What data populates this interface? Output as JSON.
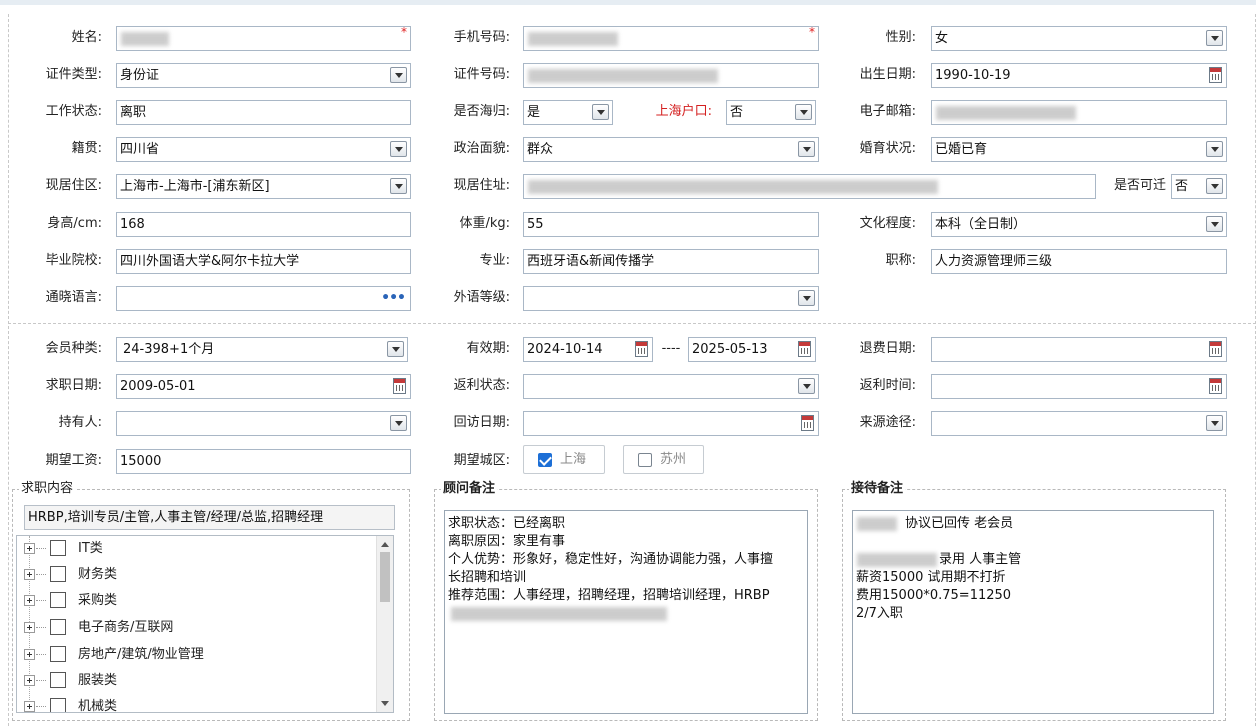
{
  "required_mark": "*",
  "basic": {
    "name": {
      "label": "姓名:",
      "value": ""
    },
    "phone": {
      "label": "手机号码:",
      "value": ""
    },
    "gender": {
      "label": "性别:",
      "value": "女"
    },
    "id_type": {
      "label": "证件类型:",
      "value": "身份证"
    },
    "id_no": {
      "label": "证件号码:",
      "value": ""
    },
    "birth": {
      "label": "出生日期:",
      "value": "1990-10-19"
    },
    "work_status": {
      "label": "工作状态:",
      "value": "离职"
    },
    "returnee": {
      "label": "是否海归:",
      "value": "是"
    },
    "shanghai_hukou": {
      "label": "上海户口:",
      "value": "否"
    },
    "email": {
      "label": "电子邮箱:",
      "value": ""
    },
    "native": {
      "label": "籍贯:",
      "value": "四川省"
    },
    "politics": {
      "label": "政治面貌:",
      "value": "群众"
    },
    "marriage": {
      "label": "婚育状况:",
      "value": "已婚已育"
    },
    "residence_area": {
      "label": "现居住区:",
      "value": "上海市-上海市-[浦东新区]"
    },
    "address": {
      "label": "现居住址:",
      "value": ""
    },
    "relocate": {
      "label": "是否可迁",
      "value": "否"
    },
    "height": {
      "label": "身高/cm:",
      "value": "168"
    },
    "weight": {
      "label": "体重/kg:",
      "value": "55"
    },
    "education": {
      "label": "文化程度:",
      "value": "本科（全日制）"
    },
    "school": {
      "label": "毕业院校:",
      "value": "四川外国语大学&阿尔卡拉大学"
    },
    "major": {
      "label": "专业:",
      "value": "西班牙语&新闻传播学"
    },
    "title": {
      "label": "职称:",
      "value": "人力资源管理师三级"
    },
    "language": {
      "label": "通晓语言:",
      "value": "",
      "more": "•••"
    },
    "fl_level": {
      "label": "外语等级:",
      "value": ""
    }
  },
  "member": {
    "type": {
      "label": "会员种类:",
      "value": "24-398+1个月"
    },
    "validity": {
      "label": "有效期:",
      "from": "2024-10-14",
      "sep": "----",
      "to": "2025-05-13"
    },
    "refund_date": {
      "label": "退费日期:",
      "value": ""
    },
    "job_date": {
      "label": "求职日期:",
      "value": "2009-05-01"
    },
    "rebate_status": {
      "label": "返利状态:",
      "value": ""
    },
    "rebate_time": {
      "label": "返利时间:",
      "value": ""
    },
    "holder": {
      "label": "持有人:",
      "value": ""
    },
    "visit_date": {
      "label": "回访日期:",
      "value": ""
    },
    "source": {
      "label": "来源途径:",
      "value": ""
    },
    "salary": {
      "label": "期望工资:",
      "value": "15000"
    },
    "city": {
      "label": "期望城区:",
      "options": [
        {
          "label": "上海",
          "checked": true
        },
        {
          "label": "苏州",
          "checked": false
        }
      ]
    }
  },
  "job_content": {
    "legend": "求职内容",
    "selected": "HRBP,培训专员/主管,人事主管/经理/总监,招聘经理",
    "tree": [
      "IT类",
      "财务类",
      "采购类",
      "电子商务/互联网",
      "房地产/建筑/物业管理",
      "服装类",
      "机械类"
    ]
  },
  "advisor_notes": {
    "legend": "顾问备注",
    "lines": [
      "求职状态：已经离职",
      "离职原因：家里有事",
      "个人优势：形象好，稳定性好，沟通协调能力强，人事擅",
      "长招聘和培训",
      "推荐范围：人事经理，招聘经理，招聘培训经理，HRBP"
    ]
  },
  "reception_notes": {
    "legend": "接待备注",
    "lines": [
      "协议已回传 老会员",
      "",
      "录用 人事主管",
      "薪资15000  试用期不打折",
      "费用15000*0.75=11250",
      "2/7入职"
    ]
  }
}
